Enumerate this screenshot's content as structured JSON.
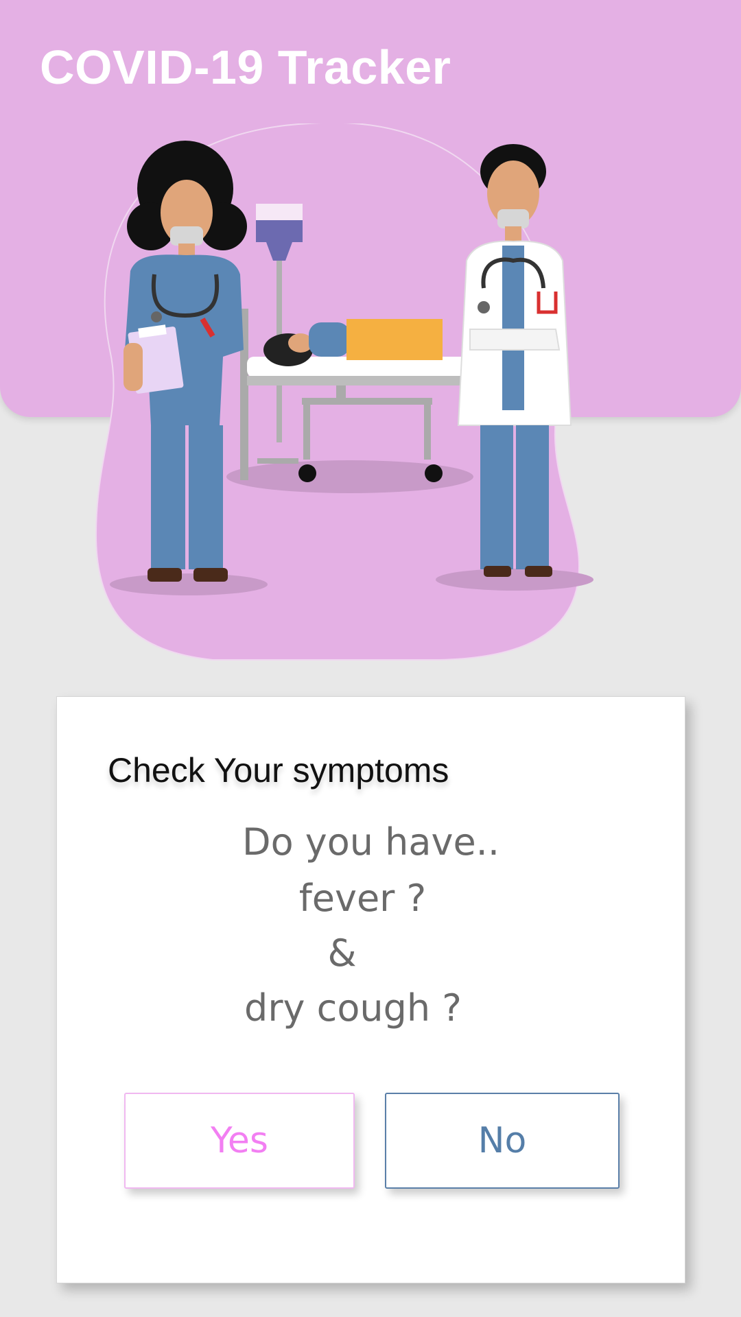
{
  "header": {
    "title": "COVID-19 Tracker",
    "background_color": "#e4b0e4"
  },
  "illustration": {
    "icon": "doctors-patient-illustration"
  },
  "symptom_card": {
    "title": "Check Your symptoms",
    "question_lines": [
      "Do you have..",
      "fever ?",
      "&",
      "dry cough ?"
    ],
    "yes_label": "Yes",
    "no_label": "No",
    "yes_color": "#f27ff2",
    "no_color": "#557ea8"
  }
}
